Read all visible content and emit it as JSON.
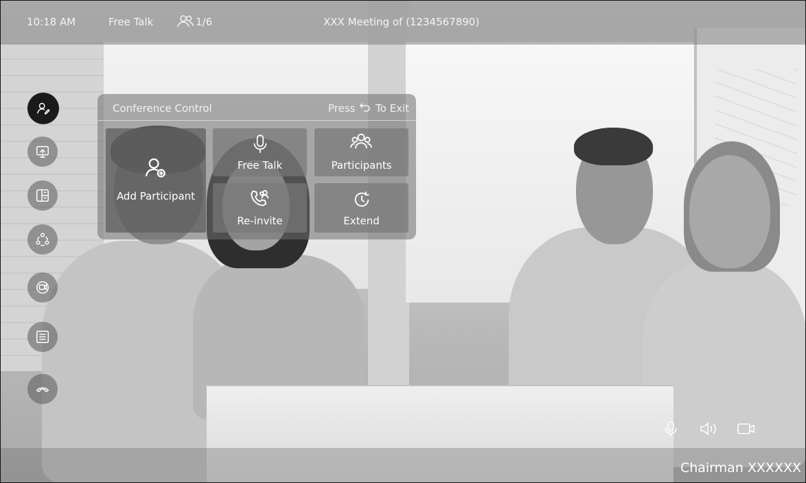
{
  "topbar": {
    "time": "10:18 AM",
    "mode": "Free Talk",
    "participant_count": "1/6",
    "meeting_title": "XXX Meeting of (1234567890)",
    "people_icon": "participants-icon"
  },
  "sidebar": {
    "items": [
      {
        "name": "participant-control-icon",
        "active": true
      },
      {
        "name": "share-screen-icon",
        "active": false
      },
      {
        "name": "layout-icon",
        "active": false
      },
      {
        "name": "switch-speaker-icon",
        "active": false
      },
      {
        "name": "video-source-icon",
        "active": false
      },
      {
        "name": "menu-list-icon",
        "active": false
      },
      {
        "name": "hang-up-icon",
        "active": false
      }
    ]
  },
  "panel": {
    "title": "Conference Control",
    "exit_prefix": "Press",
    "exit_suffix": "To Exit",
    "tiles": [
      {
        "label": "Add Participant",
        "icon": "add-participant-icon"
      },
      {
        "label": "Free Talk",
        "icon": "microphone-icon"
      },
      {
        "label": "Participants",
        "icon": "participants-icon"
      },
      {
        "label": "Re-invite",
        "icon": "reinvite-icon"
      },
      {
        "label": "Extend",
        "icon": "extend-clock-icon"
      }
    ]
  },
  "bottombar": {
    "icons": [
      "microphone-icon",
      "speaker-icon",
      "camera-icon"
    ],
    "chairman": "Chairman XXXXXX"
  },
  "colors": {
    "overlay": "#808080",
    "active_button": "#1a1a1a",
    "text": "#ffffff"
  }
}
